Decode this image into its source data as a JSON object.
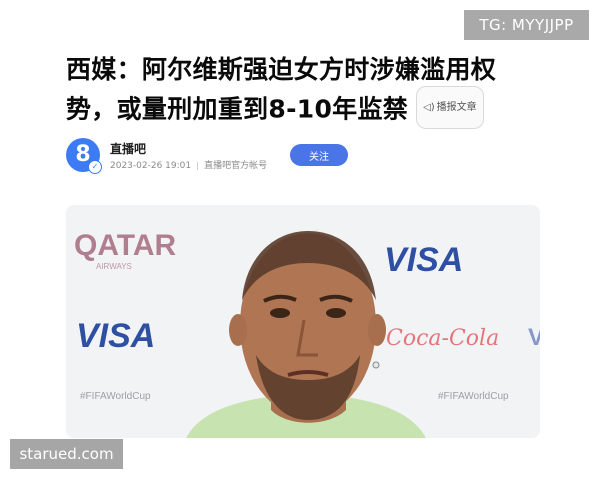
{
  "watermarks": {
    "telegram": "TG: MYYJJPP",
    "site": "starued.com"
  },
  "article": {
    "title_line1": "西媒：阿尔维斯强迫女方时涉嫌滥用权",
    "title_line2": "势，或量刑加重到8-10年监禁",
    "read_aloud_label": "播报文章",
    "author": {
      "name": "直播吧",
      "avatar_glyph": "8",
      "date": "2023-02-26 19:01",
      "account_type": "直播吧官方帐号"
    },
    "follow_label": "关注"
  },
  "photo": {
    "backdrop_texts": {
      "qatar": "QATAR",
      "airways": "AIRWAYS",
      "visa": "VISA",
      "coca_cola": "Coca-Cola",
      "hashtag": "#FIFAWorldCup"
    }
  },
  "colors": {
    "accent": "#4a75e6",
    "visa_blue": "#1a3f9a",
    "qatar_maroon": "#7a1f3a",
    "coke_red": "#d9242b",
    "jersey": "#c6e3b0"
  }
}
